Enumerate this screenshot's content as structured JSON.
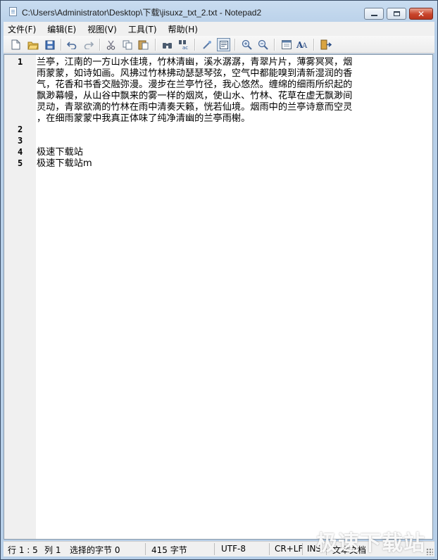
{
  "window": {
    "title": "C:\\Users\\Administrator\\Desktop\\下载\\jisuxz_txt_2.txt - Notepad2"
  },
  "menu": [
    "文件(F)",
    "编辑(E)",
    "视图(V)",
    "工具(T)",
    "帮助(H)"
  ],
  "toolbar": {
    "buttons": [
      "new-file-icon",
      "open-folder-icon",
      "save-icon",
      "undo-icon",
      "redo-icon",
      "cut-icon",
      "copy-icon",
      "paste-icon",
      "find-icon",
      "replace-icon",
      "word-wrap-icon",
      "view-toggle-icon",
      "zoom-in-icon",
      "zoom-out-icon",
      "scheme-icon",
      "font-icon",
      "exit-icon"
    ]
  },
  "editor": {
    "lines": [
      {
        "no": "1",
        "text": "兰亭，江南的一方山水佳境，竹林清幽，溪水潺潺，青翠片片，薄雾冥冥，烟"
      },
      {
        "no": "",
        "text": "雨蒙蒙，如诗如画。风拂过竹林拂动瑟瑟琴弦，空气中都能嗅到清新湿润的香"
      },
      {
        "no": "",
        "text": "气，花香和书香交融弥漫。漫步在兰亭竹径，我心悠然。缠绵的细雨所织起的"
      },
      {
        "no": "",
        "text": "飘渺幕幔，从山谷中飘来的雾一样的烟岚，使山水、竹林、花草在虚无飘渺间"
      },
      {
        "no": "",
        "text": "灵动，青翠欲滴的竹林在雨中清奏天籁，恍若仙境。烟雨中的兰亭诗意而空灵"
      },
      {
        "no": "",
        "text": "，在细雨蒙蒙中我真正体味了纯净清幽的兰亭雨榭。"
      },
      {
        "no": "2",
        "text": ""
      },
      {
        "no": "3",
        "text": ""
      },
      {
        "no": "4",
        "text": "极速下载站"
      },
      {
        "no": "5",
        "text": "极速下载站m"
      }
    ]
  },
  "status": {
    "position": "行 1 : 5",
    "column": "列 1",
    "selection": "选择的字节 0",
    "size": "415 字节",
    "encoding": "UTF-8",
    "line_ending": "CR+LF",
    "mode": "INS",
    "scheme": "文本文档"
  },
  "watermark": "极速下载站"
}
